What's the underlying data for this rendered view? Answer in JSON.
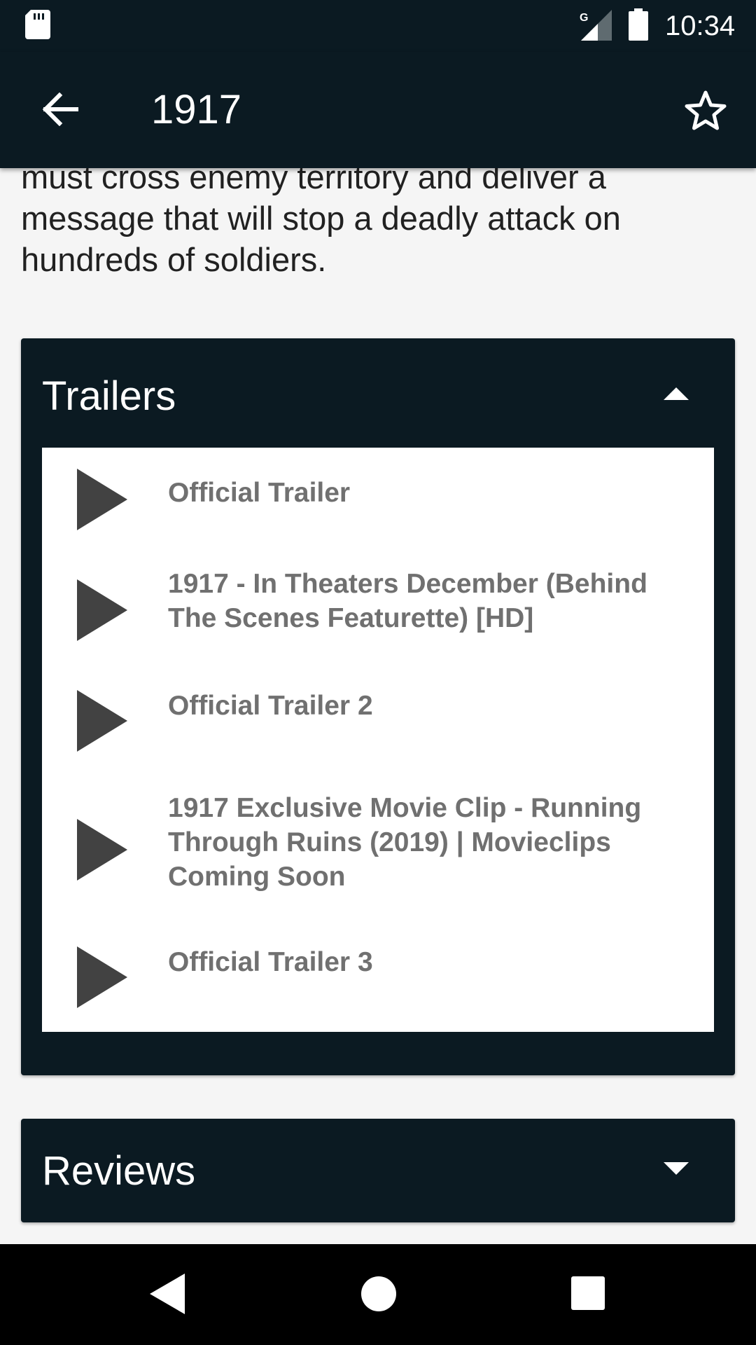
{
  "status_bar": {
    "time": "10:34",
    "network_label": "G",
    "icons": [
      "sd-card-icon",
      "signal-icon",
      "battery-icon"
    ]
  },
  "app_bar": {
    "title": "1917",
    "back_icon": "arrow-back-icon",
    "favorite_icon": "star-outline-icon"
  },
  "overview": {
    "text": "...During World War I, two young British soldiers must cross enemy territory and deliver a message that will stop a deadly attack on hundreds of soldiers."
  },
  "trailers": {
    "title": "Trailers",
    "expanded": true,
    "items": [
      {
        "title": "Official Trailer"
      },
      {
        "title": "1917 - In Theaters December (Behind The Scenes Featurette) [HD]"
      },
      {
        "title": "Official Trailer 2"
      },
      {
        "title": "1917 Exclusive Movie Clip - Running Through Ruins (2019) | Movieclips Coming Soon"
      },
      {
        "title": "Official Trailer 3"
      }
    ]
  },
  "reviews": {
    "title": "Reviews",
    "expanded": false
  },
  "nav_bar": {
    "icons": [
      "nav-back-icon",
      "nav-home-icon",
      "nav-recents-icon"
    ]
  },
  "colors": {
    "primary_dark": "#0b1a22",
    "background": "#f5f5f5",
    "trailer_text": "#707070",
    "play_icon": "#424242"
  }
}
